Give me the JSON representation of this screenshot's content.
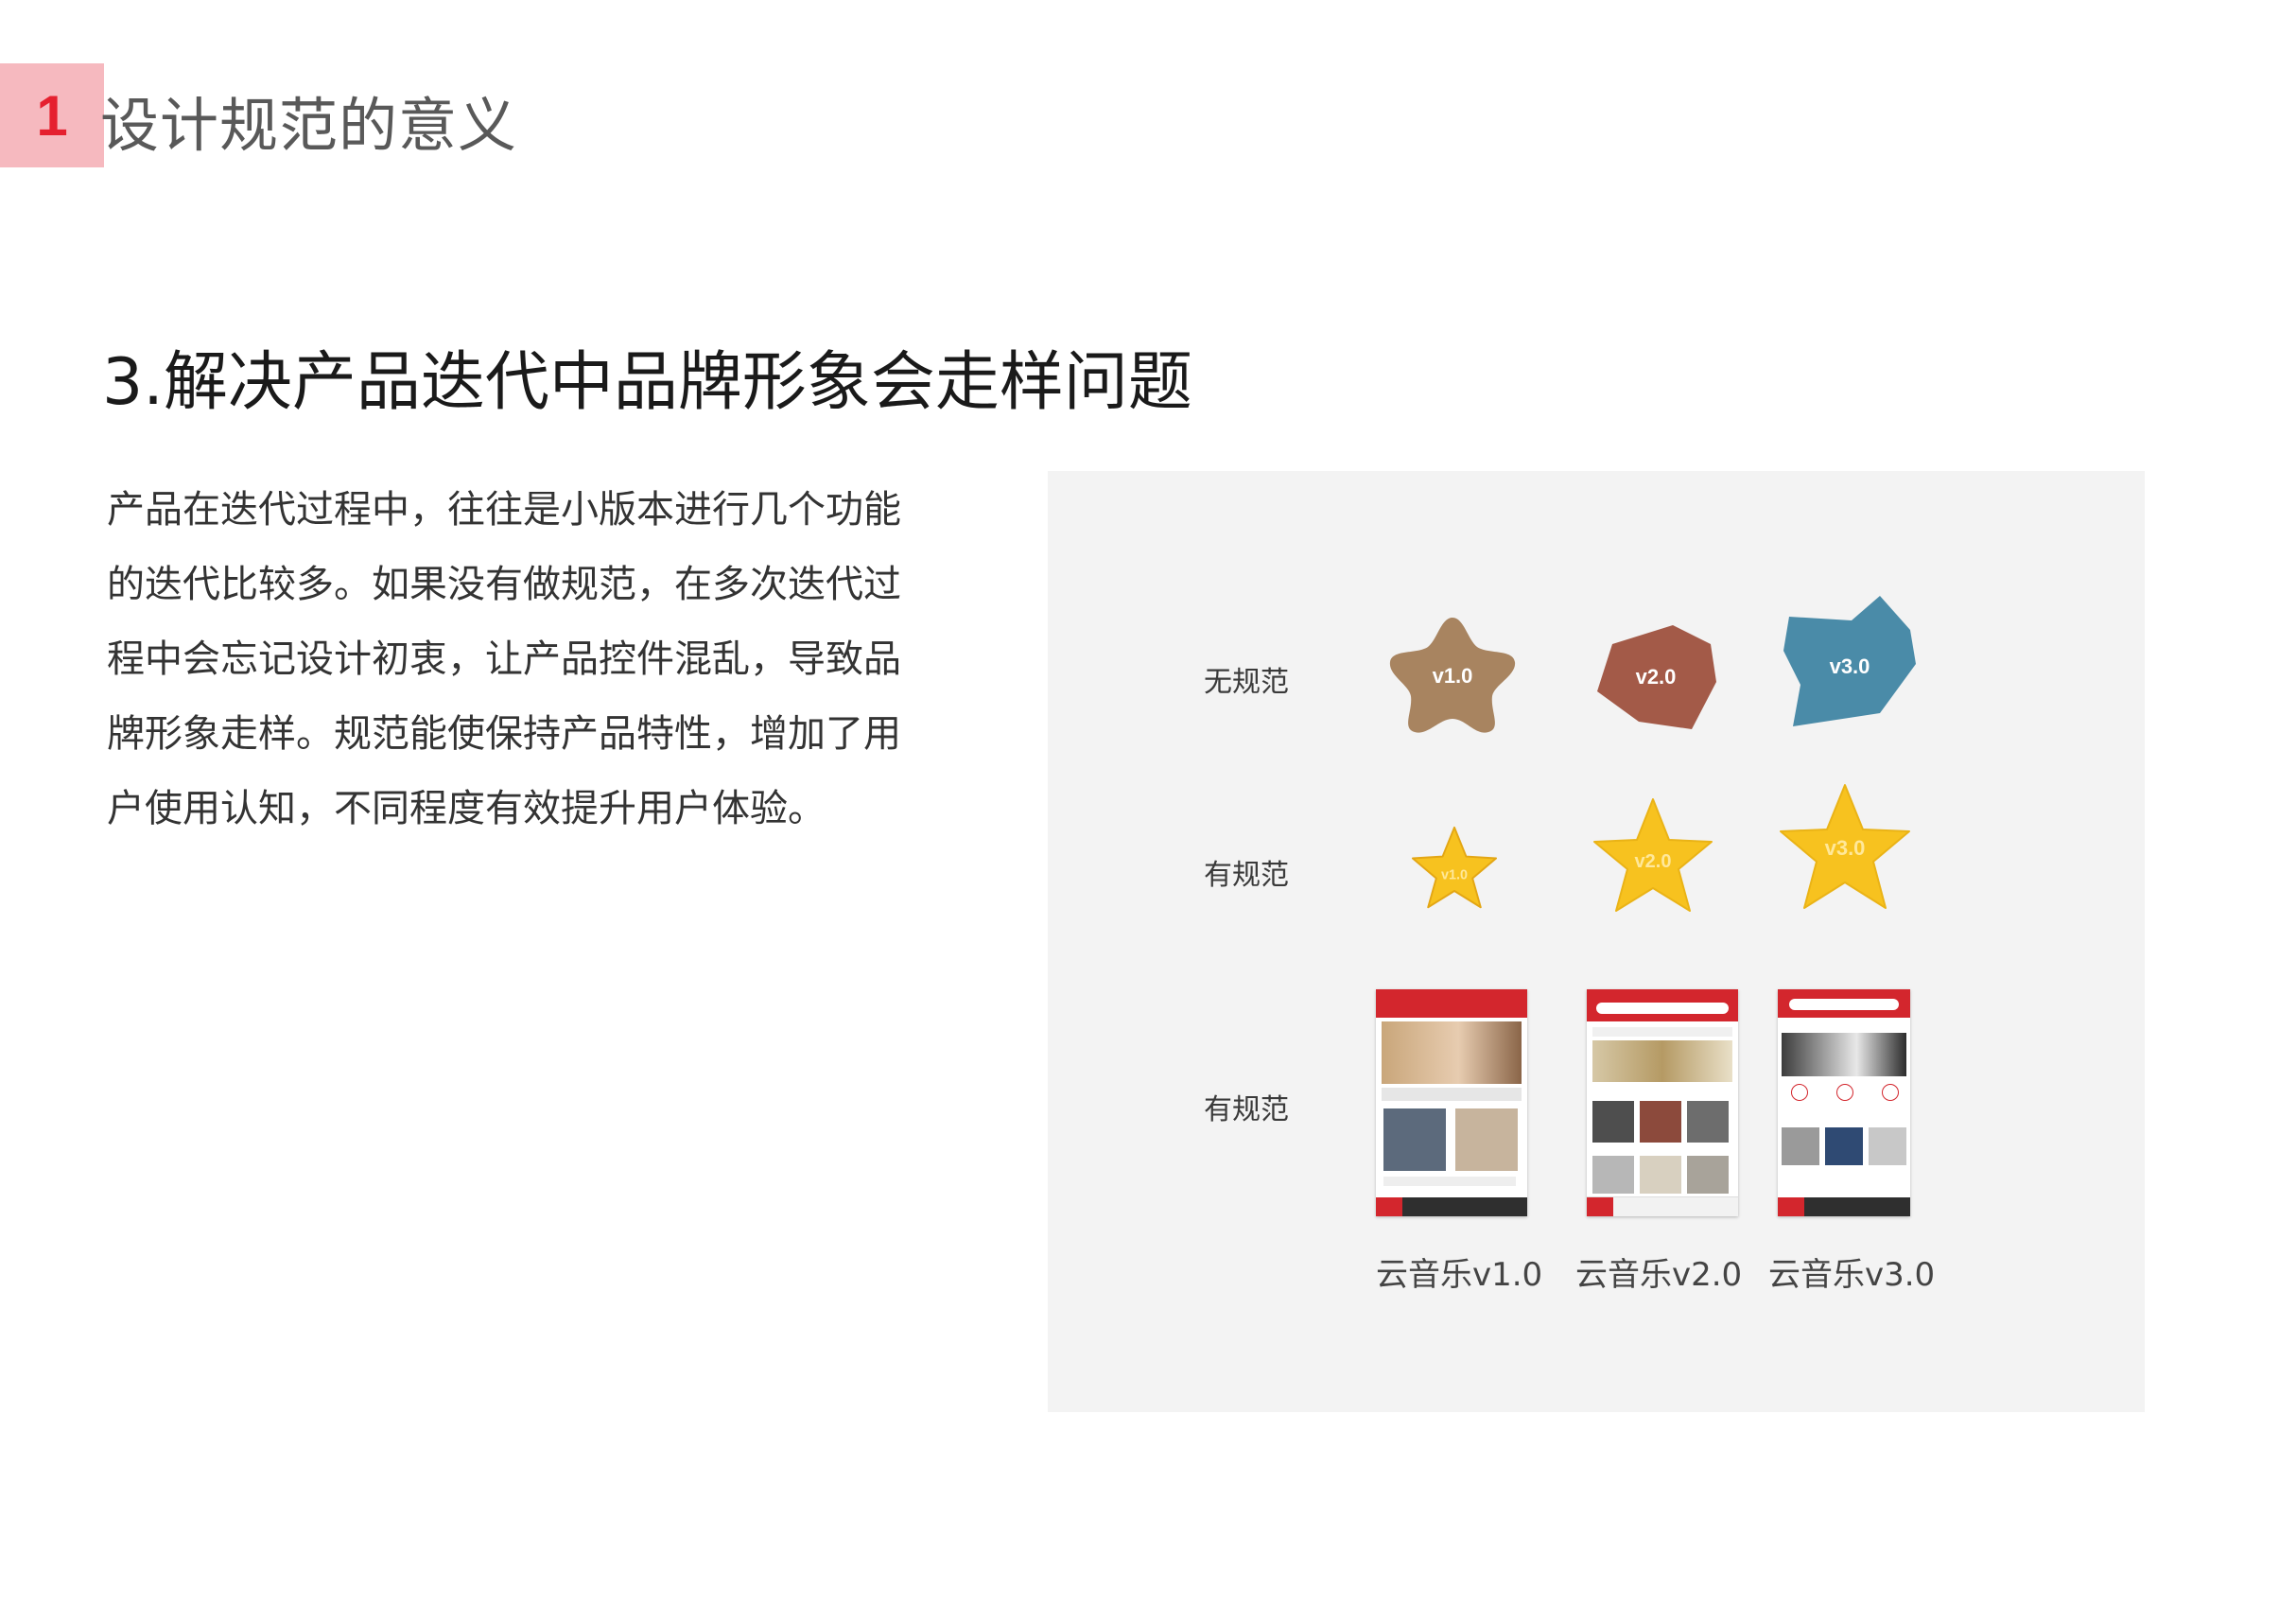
{
  "section": {
    "number": "1",
    "title": "设计规范的意义"
  },
  "heading": "3.解决产品迭代中品牌形象会走样问题",
  "body_lines": [
    "产品在迭代过程中，往往是小版本进行几个功能",
    "的迭代比较多。如果没有做规范，在多次迭代过",
    "程中会忘记设计初衷，让产品控件混乱，导致品",
    "牌形象走样。规范能使保持产品特性，增加了用",
    "户使用认知，不同程度有效提升用户体验。"
  ],
  "figure": {
    "rows": [
      {
        "label": "无规范",
        "items": [
          "v1.0",
          "v2.0",
          "v3.0"
        ]
      },
      {
        "label": "有规范",
        "items": [
          "v1.0",
          "v2.0",
          "v3.0"
        ]
      },
      {
        "label": "有规范"
      }
    ],
    "apps": [
      "云音乐v1.0",
      "云音乐v2.0",
      "云音乐v3.0"
    ],
    "colors": {
      "blob_v1": "#a88460",
      "blob_v2": "#a35a48",
      "blob_v3": "#4a8ba8",
      "star": "#f7c21f",
      "brand_red": "#d3262d"
    }
  }
}
